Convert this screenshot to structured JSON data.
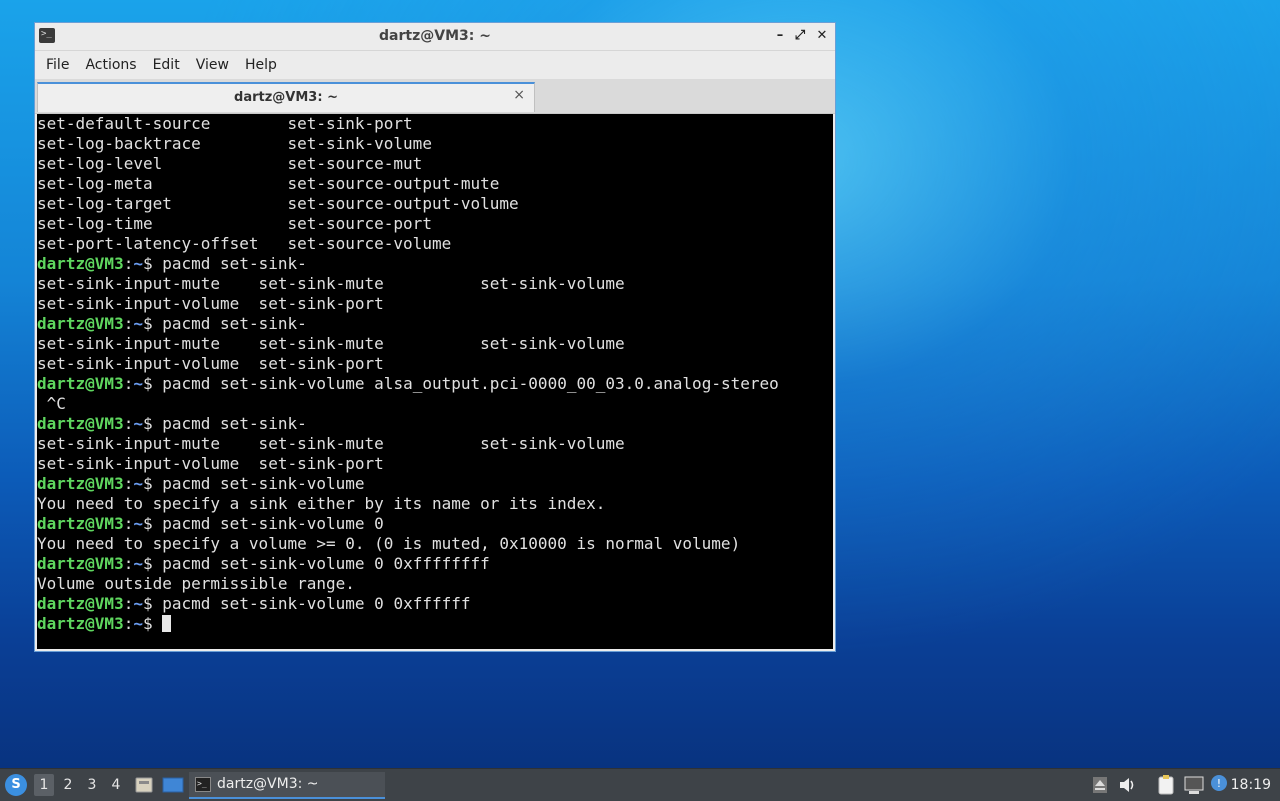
{
  "window": {
    "title": "dartz@VM3: ~",
    "app_icon": "terminal-icon",
    "controls": {
      "minimize": "–",
      "maximize": "⤢",
      "close": "✕"
    }
  },
  "menu": [
    "File",
    "Actions",
    "Edit",
    "View",
    "Help"
  ],
  "tab": {
    "label": "dartz@VM3: ~",
    "close": "×"
  },
  "prompt": {
    "user_host": "dartz@VM3",
    "colon": ":",
    "path": "~",
    "symbol": "$ "
  },
  "terminal_lines": [
    {
      "type": "out",
      "text": "set-default-source        set-sink-port"
    },
    {
      "type": "out",
      "text": "set-log-backtrace         set-sink-volume"
    },
    {
      "type": "out",
      "text": "set-log-level             set-source-mut"
    },
    {
      "type": "out",
      "text": "set-log-meta              set-source-output-mute"
    },
    {
      "type": "out",
      "text": "set-log-target            set-source-output-volume"
    },
    {
      "type": "out",
      "text": "set-log-time              set-source-port"
    },
    {
      "type": "out",
      "text": "set-port-latency-offset   set-source-volume"
    },
    {
      "type": "cmd",
      "text": "pacmd set-sink-"
    },
    {
      "type": "out",
      "text": "set-sink-input-mute    set-sink-mute          set-sink-volume"
    },
    {
      "type": "out",
      "text": "set-sink-input-volume  set-sink-port"
    },
    {
      "type": "cmd",
      "text": "pacmd set-sink-"
    },
    {
      "type": "out",
      "text": "set-sink-input-mute    set-sink-mute          set-sink-volume"
    },
    {
      "type": "out",
      "text": "set-sink-input-volume  set-sink-port"
    },
    {
      "type": "cmd",
      "text": "pacmd set-sink-volume alsa_output.pci-0000_00_03.0.analog-stereo"
    },
    {
      "type": "out",
      "text": " ^C"
    },
    {
      "type": "cmd",
      "text": "pacmd set-sink-"
    },
    {
      "type": "out",
      "text": "set-sink-input-mute    set-sink-mute          set-sink-volume"
    },
    {
      "type": "out",
      "text": "set-sink-input-volume  set-sink-port"
    },
    {
      "type": "cmd",
      "text": "pacmd set-sink-volume"
    },
    {
      "type": "out",
      "text": "You need to specify a sink either by its name or its index."
    },
    {
      "type": "cmd",
      "text": "pacmd set-sink-volume 0"
    },
    {
      "type": "out",
      "text": "You need to specify a volume >= 0. (0 is muted, 0x10000 is normal volume)"
    },
    {
      "type": "cmd",
      "text": "pacmd set-sink-volume 0 0xffffffff"
    },
    {
      "type": "out",
      "text": "Volume outside permissible range."
    },
    {
      "type": "cmd",
      "text": "pacmd set-sink-volume 0 0xffffff"
    },
    {
      "type": "cmd",
      "text": "",
      "cursor": true
    }
  ],
  "taskbar": {
    "start_icon": "lxqt-menu-icon",
    "workspaces": [
      "1",
      "2",
      "3",
      "4"
    ],
    "active_workspace": "1",
    "quicklaunch": [
      "file-manager-icon",
      "desktop-icon"
    ],
    "task": {
      "label": "dartz@VM3: ~",
      "icon": "terminal-icon"
    },
    "tray": [
      "eject-icon",
      "volume-icon",
      "clipboard-icon",
      "network-icon",
      "update-notifier-icon"
    ],
    "clock": "18:19"
  }
}
